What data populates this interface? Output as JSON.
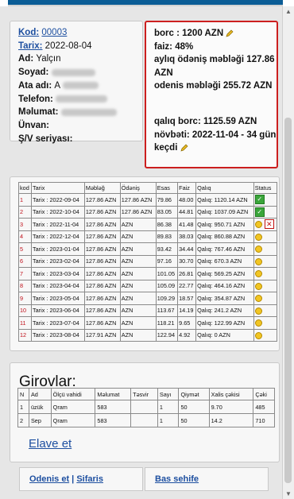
{
  "customer": {
    "kod_label": "Kod:",
    "kod_value": "00003",
    "tarix_label": "Tarix:",
    "tarix_value": "2022-08-04",
    "ad_label": "Ad:",
    "ad_value": "Yalçın",
    "soyad_label": "Soyad:",
    "ata_label": "Ata adı:",
    "ata_value": "A",
    "telefon_label": "Telefon:",
    "melumat_label": "Məlumat:",
    "unvan_label": "Ünvan:",
    "sv_label": "Ş/V seriyası:"
  },
  "debt": {
    "borc": "borc : 1200 AZN",
    "faiz": "faiz: 48%",
    "ayliq": "aylıq ödəniş məbləği 127.86 AZN",
    "odenis": "odenis məbləği 255.72 AZN",
    "qaliq": "qalıq borc: 1125.59 AZN",
    "novbeti": "növbəti: 2022-11-04 - 34 gün",
    "kecdi": "keçdi"
  },
  "table": {
    "headers": [
      "kod",
      "Tarix",
      "Məbləğ",
      "Ödəniş",
      "Esas",
      "Faiz",
      "Qalıq",
      "Status"
    ],
    "rows": [
      {
        "kod": "1",
        "tarix": "Tarix : 2022-09-04",
        "mebleg": "127.86 AZN",
        "odenis": "127.86 AZN",
        "esas": "79.86",
        "faiz": "48.00",
        "qaliq": "Qalıq: 1120.14 AZN",
        "status": "ok"
      },
      {
        "kod": "2",
        "tarix": "Tarix : 2022-10-04",
        "mebleg": "127.86 AZN",
        "odenis": "127.86 AZN",
        "esas": "83.05",
        "faiz": "44.81",
        "qaliq": "Qalıq: 1037.09 AZN",
        "status": "ok"
      },
      {
        "kod": "3",
        "tarix": "Tarix : 2022-11-04",
        "mebleg": "127.86 AZN",
        "odenis": "AZN",
        "esas": "86.38",
        "faiz": "41.48",
        "qaliq": "Qalıq: 950.71 AZN",
        "status": "late"
      },
      {
        "kod": "4",
        "tarix": "Tarix : 2022-12-04",
        "mebleg": "127.86 AZN",
        "odenis": "AZN",
        "esas": "89.83",
        "faiz": "38.03",
        "qaliq": "Qalıq: 860.88 AZN",
        "status": "pending"
      },
      {
        "kod": "5",
        "tarix": "Tarix : 2023-01-04",
        "mebleg": "127.86 AZN",
        "odenis": "AZN",
        "esas": "93.42",
        "faiz": "34.44",
        "qaliq": "Qalıq: 767.46 AZN",
        "status": "pending"
      },
      {
        "kod": "6",
        "tarix": "Tarix : 2023-02-04",
        "mebleg": "127.86 AZN",
        "odenis": "AZN",
        "esas": "97.16",
        "faiz": "30.70",
        "qaliq": "Qalıq: 670.3 AZN",
        "status": "pending"
      },
      {
        "kod": "7",
        "tarix": "Tarix : 2023-03-04",
        "mebleg": "127.86 AZN",
        "odenis": "AZN",
        "esas": "101.05",
        "faiz": "26.81",
        "qaliq": "Qalıq: 569.25 AZN",
        "status": "pending"
      },
      {
        "kod": "8",
        "tarix": "Tarix : 2023-04-04",
        "mebleg": "127.86 AZN",
        "odenis": "AZN",
        "esas": "105.09",
        "faiz": "22.77",
        "qaliq": "Qalıq: 464.16 AZN",
        "status": "pending"
      },
      {
        "kod": "9",
        "tarix": "Tarix : 2023-05-04",
        "mebleg": "127.86 AZN",
        "odenis": "AZN",
        "esas": "109.29",
        "faiz": "18.57",
        "qaliq": "Qalıq: 354.87 AZN",
        "status": "pending"
      },
      {
        "kod": "10",
        "tarix": "Tarix : 2023-06-04",
        "mebleg": "127.86 AZN",
        "odenis": "AZN",
        "esas": "113.67",
        "faiz": "14.19",
        "qaliq": "Qalıq: 241.2 AZN",
        "status": "pending"
      },
      {
        "kod": "11",
        "tarix": "Tarix : 2023-07-04",
        "mebleg": "127.86 AZN",
        "odenis": "AZN",
        "esas": "118.21",
        "faiz": "9.65",
        "qaliq": "Qalıq: 122.99 AZN",
        "status": "pending"
      },
      {
        "kod": "12",
        "tarix": "Tarix : 2023-08-04",
        "mebleg": "127.91 AZN",
        "odenis": "AZN",
        "esas": "122.94",
        "faiz": "4.92",
        "qaliq": "Qalıq: 0 AZN",
        "status": "pending"
      }
    ]
  },
  "girov": {
    "title": "Girovlar:",
    "headers": [
      "N",
      "Ad",
      "Ölçü vahidi",
      "Məlumat",
      "Təsvir",
      "Sayı",
      "Qiymət",
      "Xalis çəkisi",
      "Çəki"
    ],
    "rows": [
      [
        "1",
        "üzük",
        "Qram",
        "583",
        "",
        "1",
        "50",
        "9.70",
        "485"
      ],
      [
        "2",
        "Sep",
        "Qram",
        "583",
        "",
        "1",
        "50",
        "14.2",
        "710"
      ]
    ],
    "add_link": "Elave et"
  },
  "footer": {
    "odenis": "Odenis et",
    "sep": " | ",
    "sifaris": "Sifaris",
    "bas": "Bas sehife"
  }
}
